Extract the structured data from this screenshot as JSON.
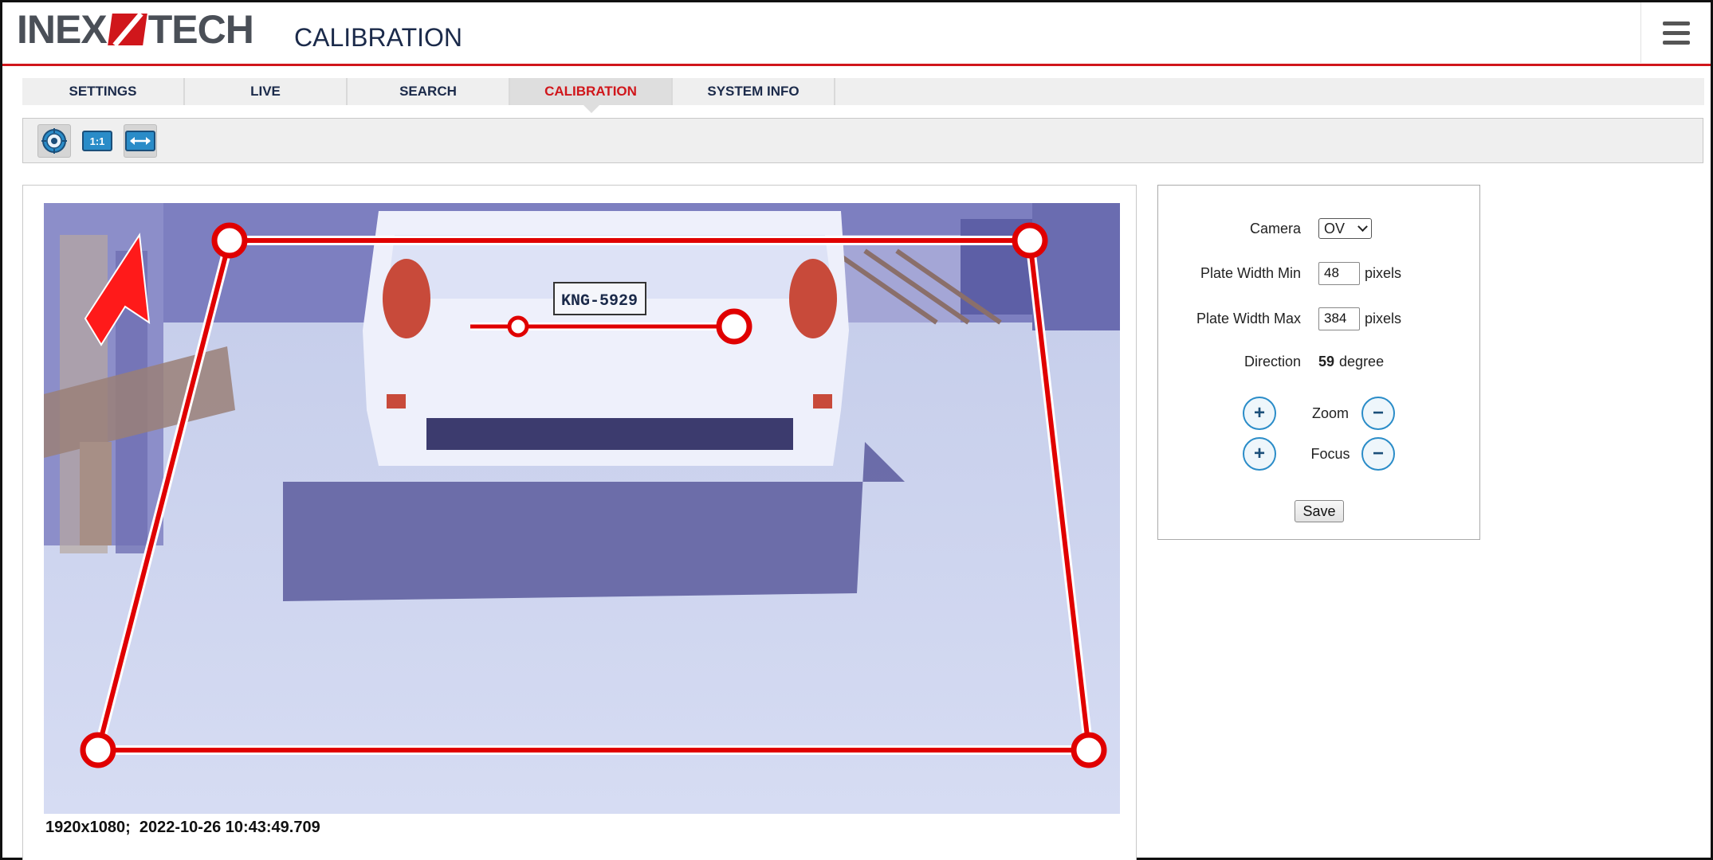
{
  "header": {
    "logo_left": "INEX",
    "logo_right": "TECH",
    "page_title": "CALIBRATION"
  },
  "tabs": [
    {
      "label": "SETTINGS",
      "active": false
    },
    {
      "label": "LIVE",
      "active": false
    },
    {
      "label": "SEARCH",
      "active": false
    },
    {
      "label": "CALIBRATION",
      "active": true
    },
    {
      "label": "SYSTEM INFO",
      "active": false
    }
  ],
  "toolbar": {
    "tools": [
      {
        "icon": "target-icon",
        "pressed": true
      },
      {
        "icon": "ratio-1-1-icon",
        "label": "1:1",
        "pressed": false
      },
      {
        "icon": "fit-width-icon",
        "pressed": true
      }
    ]
  },
  "video": {
    "plate_text": "KNG-5929",
    "info": "1920x1080;  2022-10-26 10:43:49.709"
  },
  "settings": {
    "camera_label": "Camera",
    "camera_value": "OV",
    "plate_width_min_label": "Plate Width Min",
    "plate_width_min_value": "48",
    "plate_width_max_label": "Plate Width Max",
    "plate_width_max_value": "384",
    "pixels_unit": "pixels",
    "direction_label": "Direction",
    "direction_value": "59",
    "direction_unit": "degree",
    "zoom_label": "Zoom",
    "focus_label": "Focus",
    "plus_glyph": "+",
    "minus_glyph": "−",
    "save_label": "Save"
  },
  "colors": {
    "accent": "#d0161b",
    "nav_text": "#1b2a4a",
    "button_border": "#2a8cc8"
  }
}
